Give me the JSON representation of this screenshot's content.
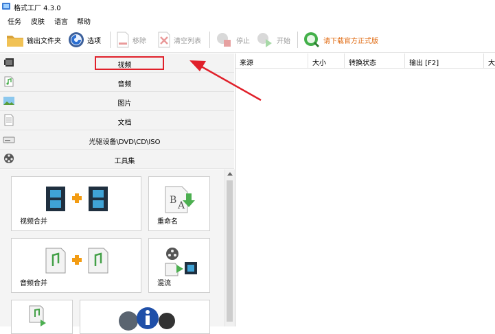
{
  "window": {
    "title": "格式工厂 4.3.0"
  },
  "menu": [
    "任务",
    "皮肤",
    "语言",
    "帮助"
  ],
  "toolbar": {
    "output_folder": "输出文件夹",
    "options": "选项",
    "remove": "移除",
    "clear_list": "清空列表",
    "stop": "停止",
    "start": "开始",
    "download_official": "请下载官方正式版"
  },
  "categories": [
    "视频",
    "音频",
    "图片",
    "文档",
    "光驱设备\\DVD\\CD\\ISO",
    "工具集"
  ],
  "tools": [
    "视频合并",
    "重命名",
    "音频合并",
    "混流"
  ],
  "columns": [
    "来源",
    "大小",
    "转换状态",
    "输出 [F2]",
    "大"
  ],
  "colors": {
    "highlight": "#e0202a",
    "link": "#e06a10"
  }
}
